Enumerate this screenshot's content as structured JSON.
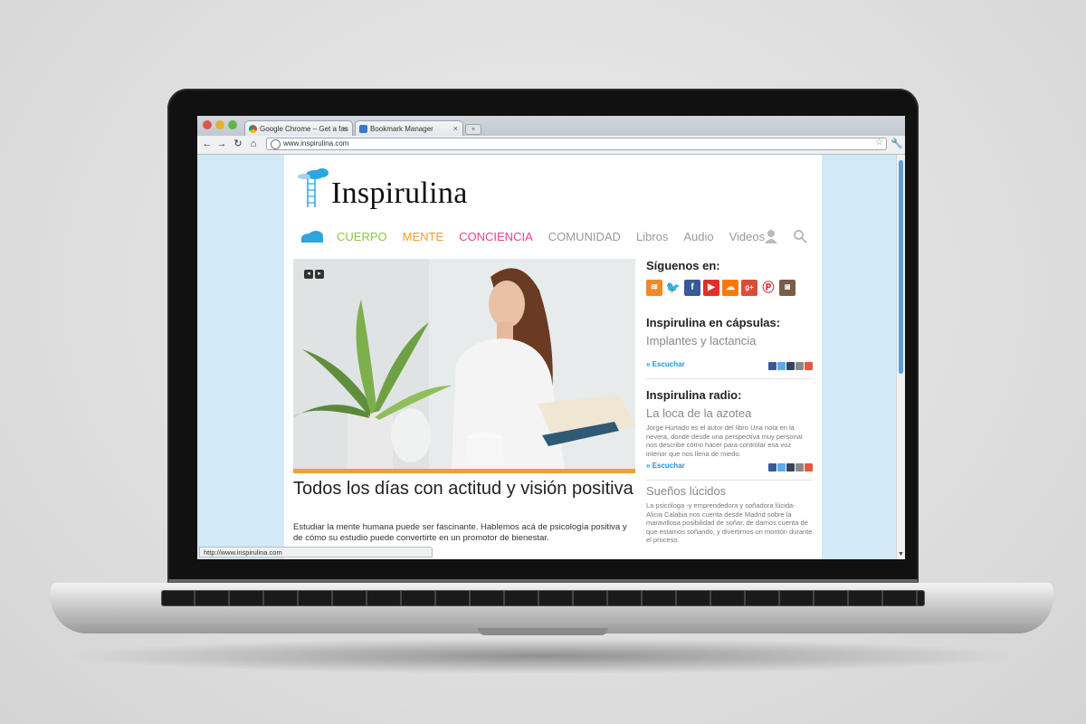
{
  "browser": {
    "tabs": [
      {
        "label": "Google Chrome – Get a fas"
      },
      {
        "label": "Bookmark Manager"
      }
    ],
    "url": "www.inspirulina.com",
    "status_url": "http://www.inspirulina.com"
  },
  "site": {
    "logo": "Inspirulina",
    "nav": [
      {
        "label": "CUERPO",
        "color": "#8cc63f"
      },
      {
        "label": "MENTE",
        "color": "#f39c33"
      },
      {
        "label": "CONCIENCIA",
        "color": "#e9408f"
      },
      {
        "label": "COMUNIDAD",
        "color": "#9a9a9a"
      },
      {
        "label": "Libros",
        "color": "#9a9a9a"
      },
      {
        "label": "Audio",
        "color": "#9a9a9a"
      },
      {
        "label": "Videos",
        "color": "#9a9a9a"
      }
    ],
    "hero": {
      "headline": "Todos los días con actitud y visión positiva",
      "lead": "Estudiar la mente humana puede ser fascinante. Hablemos acá de psicología positiva y de cómo su estudio puede convertirte en un promotor de bienestar."
    },
    "sidebar": {
      "follow_title": "Síguenos en:",
      "social_icons": [
        "rss-icon",
        "twitter-icon",
        "facebook-icon",
        "youtube-icon",
        "soundcloud-icon",
        "google-plus-icon",
        "pinterest-icon",
        "instagram-icon"
      ],
      "capsulas_title": "Inspirulina en cápsulas:",
      "capsulas_item": "Implantes y lactancia",
      "listen_label": "» Escuchar",
      "radio_title": "Inspirulina radio:",
      "radio_item": "La loca de la azotea",
      "radio_desc": "Jorge Hurtado es el autor del libro Una nota en la nevera, donde desde una perspectiva muy personal nos describe cómo hacer para controlar esa voz interior que nos llena de miedo.",
      "suenos_title": "Sueños lúcidos",
      "suenos_desc": "La psicóloga -y emprendedora y soñadora lúcida- Alicia Calabia nos cuenta desde Madrid sobre la maravillosa posibilidad de soñar, de darnos cuenta de que estamos soñando, y divertirnos un montón durante el proceso."
    }
  }
}
